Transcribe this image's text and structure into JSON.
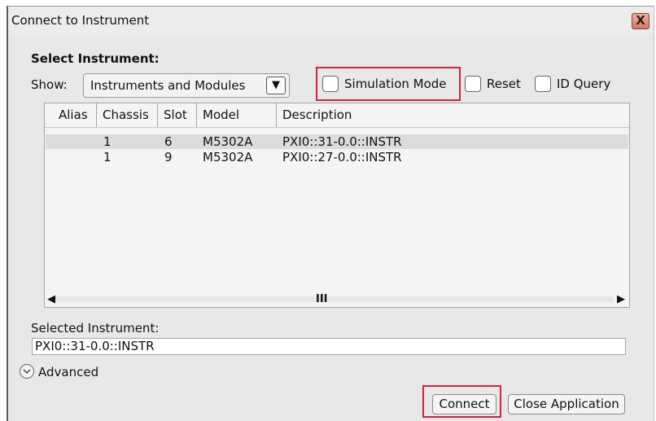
{
  "window": {
    "title": "Connect to Instrument",
    "close_glyph": "X"
  },
  "select_section": {
    "heading": "Select Instrument:"
  },
  "show": {
    "label": "Show:",
    "value": "Instruments and Modules",
    "arrow_glyph": "▼"
  },
  "options": {
    "simulation_mode": "Simulation Mode",
    "reset": "Reset",
    "id_query": "ID Query"
  },
  "table": {
    "headers": [
      "Alias",
      "Chassis",
      "Slot",
      "Model",
      "Description"
    ],
    "rows": [
      {
        "alias": "",
        "chassis": "1",
        "slot": "6",
        "model": "M5302A",
        "description": "PXI0::31-0.0::INSTR",
        "selected": true
      },
      {
        "alias": "",
        "chassis": "1",
        "slot": "9",
        "model": "M5302A",
        "description": "PXI0::27-0.0::INSTR",
        "selected": false
      }
    ],
    "scroll_left_glyph": "◀",
    "scroll_right_glyph": "▶",
    "scroll_grip_glyph": "III"
  },
  "selected_instrument": {
    "label": "Selected Instrument:",
    "value": "PXI0::31-0.0::INSTR"
  },
  "advanced": {
    "label": "Advanced",
    "icon": "chevron-down-icon"
  },
  "buttons": {
    "connect": "Connect",
    "close_application": "Close Application"
  },
  "colors": {
    "highlight_red": "#d4213d",
    "dialog_bg": "#e8e8e8",
    "selected_row": "#dcdcdc"
  }
}
